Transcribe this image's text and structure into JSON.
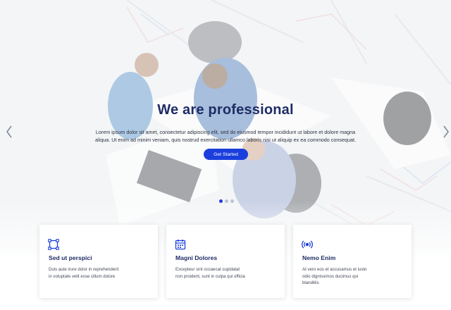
{
  "hero": {
    "title": "We are professional",
    "description": "Lorem ipsum dolor sit amet, consectetur adipiscing elit, sed do eiusmod tempor incididunt ut labore et dolore magna aliqua. Ut enim ad minim veniam, quis nostrud exercitation ullamco laboris nisi ut aliquip ex ea commodo consequat.",
    "cta_label": "Get Started",
    "slides_count": 3,
    "active_slide": 1,
    "prev_icon": "chevron-left-icon",
    "next_icon": "chevron-right-icon"
  },
  "features": [
    {
      "icon": "frame-icon",
      "title": "Sed ut perspici",
      "description": "Duis aute irure dolor in reprehenderit in voluptate velit esse cillum dolore"
    },
    {
      "icon": "calendar-icon",
      "title": "Magni Dolores",
      "description": "Excepteur sint occaecat cupidatat non proident, sunt in culpa qui officia"
    },
    {
      "icon": "broadcast-icon",
      "title": "Nemo Enim",
      "description": "At vero eos et accusamus et iusto odio dignissimos ducimus qui blanditiis"
    }
  ],
  "colors": {
    "accent": "#1b3fdc",
    "heading": "#1f2d66",
    "text": "#444a56"
  }
}
